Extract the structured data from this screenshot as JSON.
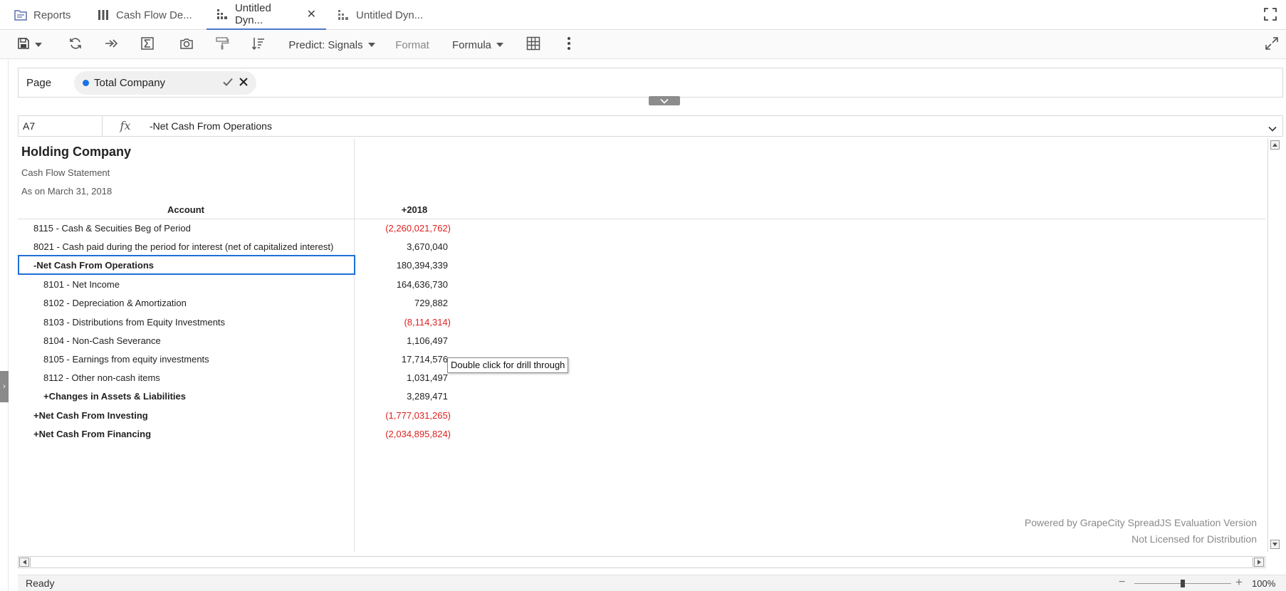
{
  "tabs": [
    {
      "label": "Reports",
      "icon": "reports-folder-icon",
      "active": false,
      "closable": false
    },
    {
      "label": "Cash Flow De...",
      "icon": "grid-icon",
      "active": false,
      "closable": false
    },
    {
      "label": "Untitled Dyn...",
      "icon": "dynamic-report-icon",
      "active": true,
      "closable": true
    },
    {
      "label": "Untitled Dyn...",
      "icon": "dynamic-report-icon",
      "active": false,
      "closable": false
    }
  ],
  "toolbar": {
    "predict_label": "Predict: Signals",
    "format_label": "Format",
    "formula_label": "Formula",
    "icons": [
      "save-icon",
      "refresh-icon",
      "run-icon",
      "formula-sum-icon",
      "camera-icon",
      "paint-brush-icon",
      "sort-filter-icon",
      "table-grid-icon",
      "more-vertical-icon",
      "expand-icon"
    ]
  },
  "page_filter": {
    "label": "Page",
    "chip_label": "Total Company",
    "chip_dot_color": "#1a73e8"
  },
  "formula_bar": {
    "cell_ref": "A7",
    "fx_label": "fx",
    "content": "-Net Cash From Operations"
  },
  "sheet": {
    "company": "Holding Company",
    "subtitle": "Cash Flow Statement",
    "date": "As on March 31, 2018",
    "col_account": "Account",
    "col_year": "+2018",
    "rows": [
      {
        "label": "8115 - Cash & Secuities Beg of Period",
        "value": "(2,260,021,762)",
        "negative": true,
        "bold": false,
        "indent": 1
      },
      {
        "label": "8021 - Cash paid during the period for interest (net of capitalized interest)",
        "value": "3,670,040",
        "negative": false,
        "bold": false,
        "indent": 1
      },
      {
        "label": "-Net Cash From Operations",
        "value": "180,394,339",
        "negative": false,
        "bold": true,
        "indent": 1
      },
      {
        "label": "8101 - Net Income",
        "value": "164,636,730",
        "negative": false,
        "bold": false,
        "indent": 2
      },
      {
        "label": "8102 - Depreciation & Amortization",
        "value": "729,882",
        "negative": false,
        "bold": false,
        "indent": 2
      },
      {
        "label": "8103 - Distributions from Equity Investments",
        "value": "(8,114,314)",
        "negative": true,
        "bold": false,
        "indent": 2
      },
      {
        "label": "8104 - Non-Cash Severance",
        "value": "1,106,497",
        "negative": false,
        "bold": false,
        "indent": 2
      },
      {
        "label": "8105 - Earnings from equity investments",
        "value": "17,714,576",
        "negative": false,
        "bold": false,
        "indent": 2
      },
      {
        "label": "8112 - Other non-cash items",
        "value": "1,031,497",
        "negative": false,
        "bold": false,
        "indent": 2
      },
      {
        "label": "+Changes in Assets & Liabilities",
        "value": "3,289,471",
        "negative": false,
        "bold": true,
        "indent": 2
      },
      {
        "label": "+Net Cash From Investing",
        "value": "(1,777,031,265)",
        "negative": true,
        "bold": true,
        "indent": 1
      },
      {
        "label": "+Net Cash From Financing",
        "value": "(2,034,895,824)",
        "negative": true,
        "bold": true,
        "indent": 1
      }
    ],
    "tooltip": "Double click for drill through",
    "watermark_line1": "Powered by GrapeCity SpreadJS Evaluation Version",
    "watermark_line2": "Not Licensed for Distribution",
    "negative_color": "#e02020",
    "selection_color": "#1f6fd6"
  },
  "status": {
    "text": "Ready",
    "zoom": "100%"
  }
}
